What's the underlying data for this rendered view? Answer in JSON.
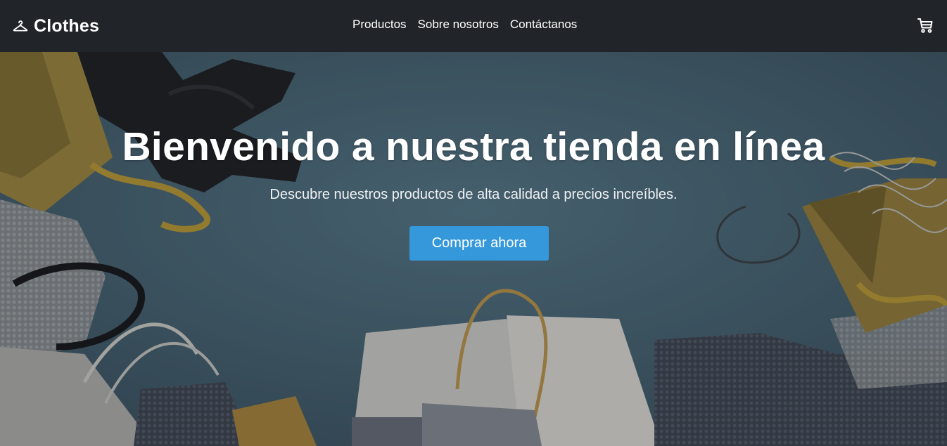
{
  "navbar": {
    "brand": {
      "icon": "hanger-icon",
      "name": "Clothes"
    },
    "links": [
      {
        "label": "Productos"
      },
      {
        "label": "Sobre nosotros"
      },
      {
        "label": "Contáctanos"
      }
    ],
    "cart": {
      "icon": "cart-icon"
    }
  },
  "hero": {
    "title": "Bienvenido a nuestra tienda en línea",
    "subtitle": "Descubre nuestros productos de alta calidad a precios increíbles.",
    "cta_label": "Comprar ahora"
  },
  "colors": {
    "navbar_bg": "#212529",
    "accent": "#3498db",
    "hero_bg": "#4a6674"
  }
}
